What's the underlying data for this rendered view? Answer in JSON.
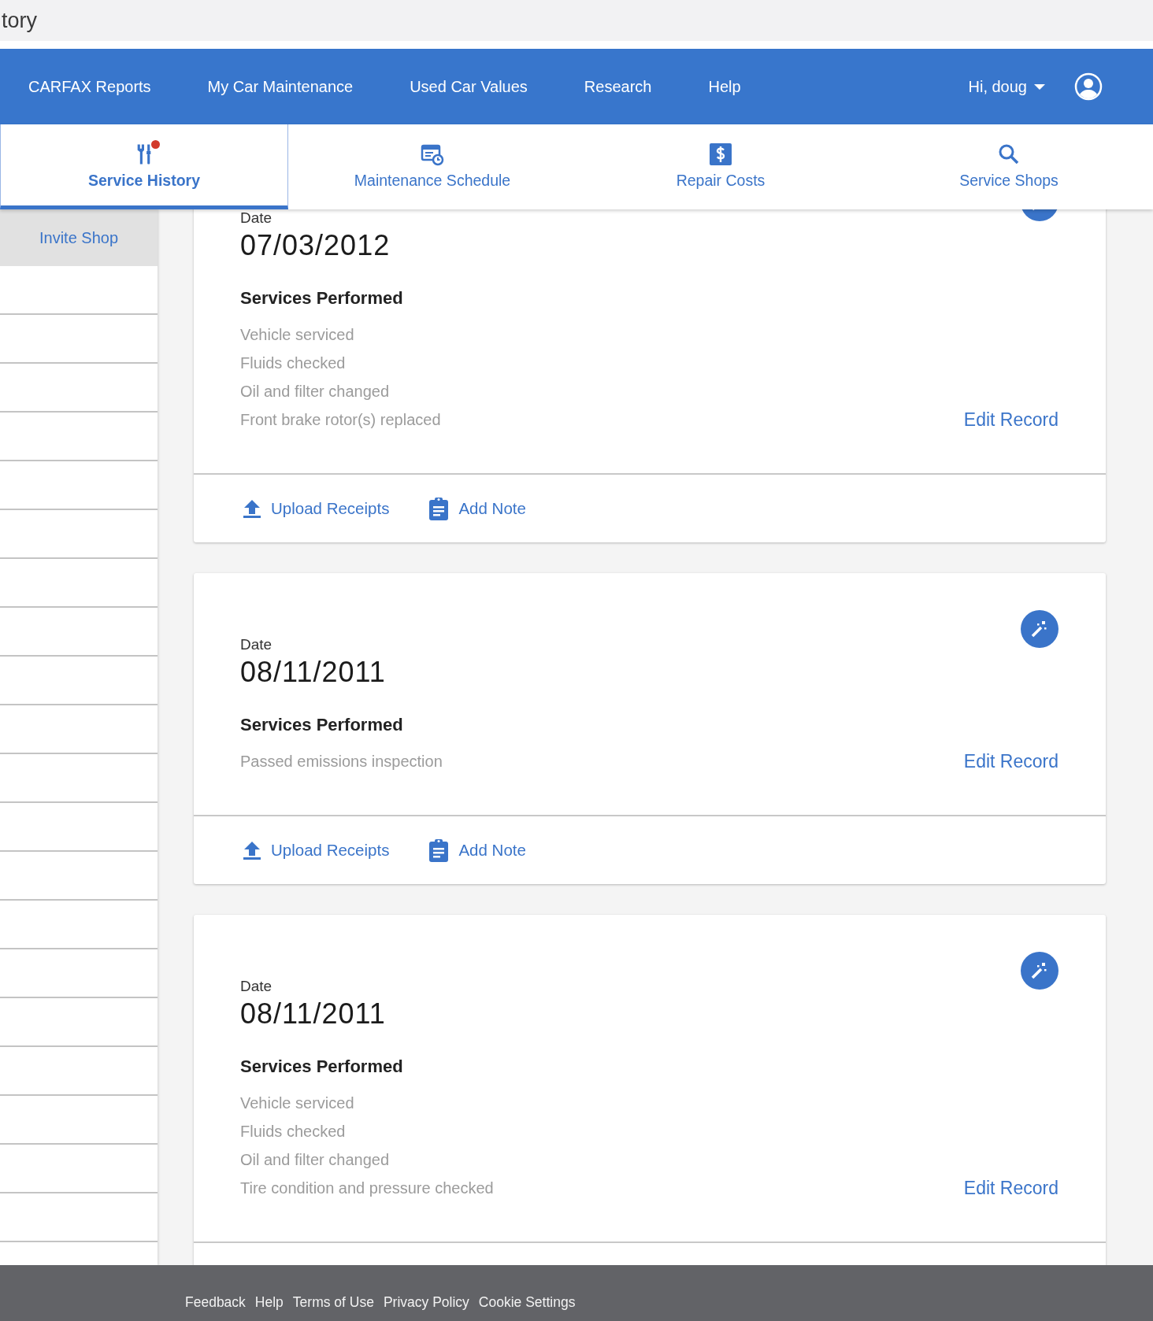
{
  "page_title_fragment": "tory",
  "nav": {
    "items": [
      "CARFAX Reports",
      "My Car Maintenance",
      "Used Car Values",
      "Research",
      "Help"
    ],
    "greeting": "Hi, doug"
  },
  "tabs": [
    {
      "label": "Service History",
      "kind": "history",
      "selected": true,
      "alert": true
    },
    {
      "label": "Maintenance Schedule",
      "kind": "schedule",
      "selected": false,
      "alert": false
    },
    {
      "label": "Repair Costs",
      "kind": "costs",
      "selected": false,
      "alert": false
    },
    {
      "label": "Service Shops",
      "kind": "shops",
      "selected": false,
      "alert": false
    }
  ],
  "sidebar": {
    "items": [
      "Invite Shop"
    ]
  },
  "records": [
    {
      "date_label": "Date",
      "date": "07/03/2012",
      "heading": "Services Performed",
      "services": [
        "Vehicle serviced",
        "Fluids checked",
        "Oil and filter changed",
        "Front brake rotor(s) replaced"
      ],
      "edit": "Edit Record",
      "actions": [
        {
          "kind": "upload",
          "label": "Upload Receipts"
        },
        {
          "kind": "note",
          "label": "Add Note"
        }
      ]
    },
    {
      "date_label": "Date",
      "date": "08/11/2011",
      "heading": "Services Performed",
      "services": [
        "Passed emissions inspection"
      ],
      "edit": "Edit Record",
      "actions": [
        {
          "kind": "upload",
          "label": "Upload Receipts"
        },
        {
          "kind": "note",
          "label": "Add Note"
        }
      ]
    },
    {
      "date_label": "Date",
      "date": "08/11/2011",
      "heading": "Services Performed",
      "services": [
        "Vehicle serviced",
        "Fluids checked",
        "Oil and filter changed",
        "Tire condition and pressure checked"
      ],
      "edit": "Edit Record"
    }
  ],
  "footer": [
    "Feedback",
    "Help",
    "Terms of Use",
    "Privacy Policy",
    "Cookie Settings"
  ]
}
